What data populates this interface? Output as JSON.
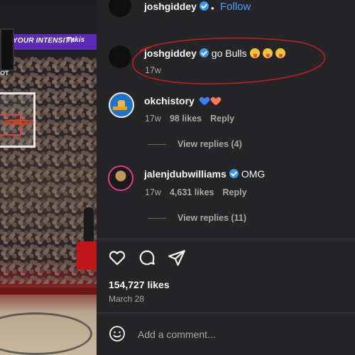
{
  "photo": {
    "banner_text": "YOUR INTENSITY",
    "banner_logo": "Takis",
    "shot_clock_label": "OT"
  },
  "header": {
    "username": "joshgiddey",
    "separator": "•",
    "follow_label": "Follow"
  },
  "comments": [
    {
      "username": "joshgiddey",
      "text": "go Bulls",
      "emojis": [
        "squinting-face-with-tongue",
        "squinting-face-with-tongue",
        "squinting-face-with-tongue"
      ],
      "age": "17w"
    },
    {
      "username": "okchistory",
      "text": "",
      "emojis": [
        "blue-heart",
        "orange-heart"
      ],
      "age": "17w",
      "likes": "98 likes",
      "reply_label": "Reply",
      "view_replies": "View replies (4)"
    },
    {
      "username": "jalenjdubwilliams",
      "text": "OMG",
      "age": "17w",
      "likes": "4,631 likes",
      "reply_label": "Reply",
      "view_replies": "View replies (11)"
    }
  ],
  "post": {
    "likes_count": "154,727 likes",
    "date": "March 28"
  },
  "comment_box": {
    "placeholder": "Add a comment..."
  },
  "colors": {
    "panel_bg": "#252528",
    "link_blue": "#4a9eff",
    "annotation_red": "#c81e1e"
  },
  "icons": {
    "like": "heart-icon",
    "comment": "comment-bubble-icon",
    "share": "paper-plane-icon",
    "emoji": "smiley-icon",
    "verified": "verified-badge-icon"
  }
}
